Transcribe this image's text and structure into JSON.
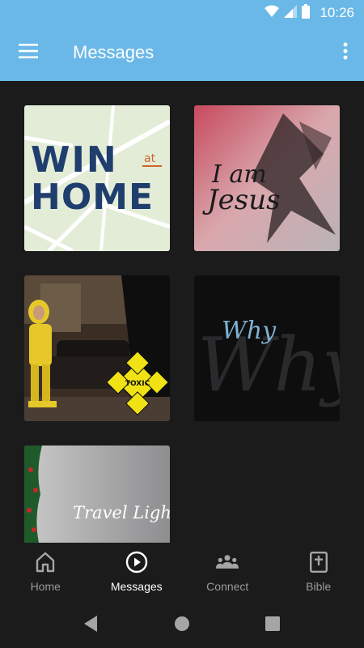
{
  "status_bar": {
    "time": "10:26"
  },
  "app_bar": {
    "title": "Messages"
  },
  "cards": [
    {
      "title_line1": "WIN",
      "title_at": "at",
      "title_line2": "HOME"
    },
    {
      "title_line1": "I am",
      "title_line2": "Jesus"
    },
    {
      "badge": "TOXIC"
    },
    {
      "title_primary": "Why",
      "title_watermark": "Why"
    },
    {
      "title": "Travel Light"
    }
  ],
  "bottom_nav": [
    {
      "label": "Home",
      "icon": "home-icon"
    },
    {
      "label": "Messages",
      "icon": "play-circle-icon",
      "active": true
    },
    {
      "label": "Connect",
      "icon": "group-icon"
    },
    {
      "label": "Bible",
      "icon": "bible-icon"
    }
  ],
  "colors": {
    "accent": "#6ab8e8",
    "background": "#1b1b1c"
  }
}
